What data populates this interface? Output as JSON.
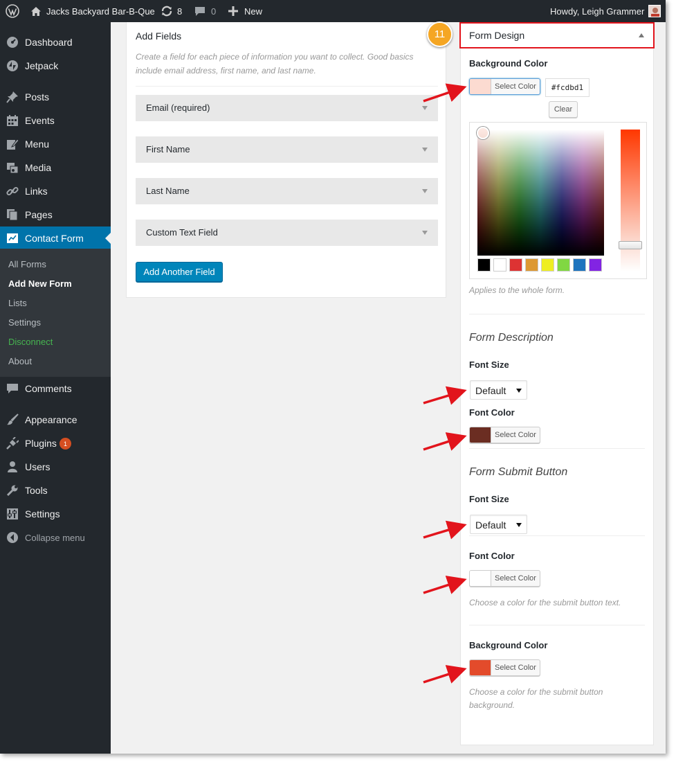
{
  "admin_bar": {
    "site_name": "Jacks Backyard Bar-B-Que",
    "updates_count": "8",
    "comments_count": "0",
    "new_label": "New",
    "howdy": "Howdy, Leigh Grammer"
  },
  "sidebar": {
    "items": [
      {
        "label": "Dashboard",
        "icon": "dashboard-icon"
      },
      {
        "label": "Jetpack",
        "icon": "jetpack-icon"
      },
      {
        "label": "Posts",
        "icon": "pin-icon"
      },
      {
        "label": "Events",
        "icon": "calendar-icon"
      },
      {
        "label": "Menu",
        "icon": "edit-icon"
      },
      {
        "label": "Media",
        "icon": "media-icon"
      },
      {
        "label": "Links",
        "icon": "link-icon"
      },
      {
        "label": "Pages",
        "icon": "pages-icon"
      },
      {
        "label": "Contact Form",
        "icon": "contact-form-icon"
      },
      {
        "label": "Comments",
        "icon": "comment-icon"
      },
      {
        "label": "Appearance",
        "icon": "brush-icon"
      },
      {
        "label": "Plugins",
        "icon": "plugin-icon",
        "badge": "1"
      },
      {
        "label": "Users",
        "icon": "user-icon"
      },
      {
        "label": "Tools",
        "icon": "wrench-icon"
      },
      {
        "label": "Settings",
        "icon": "settings-icon"
      },
      {
        "label": "Collapse menu",
        "icon": "collapse-icon"
      }
    ],
    "submenu": [
      "All Forms",
      "Add New Form",
      "Lists",
      "Settings",
      "Disconnect",
      "About"
    ]
  },
  "add_fields": {
    "title": "Add Fields",
    "description": "Create a field for each piece of information you want to collect. Good basics include email address, first name, and last name.",
    "fields": [
      "Email (required)",
      "First Name",
      "Last Name",
      "Custom Text Field"
    ],
    "add_button": "Add Another Field"
  },
  "form_design": {
    "title": "Form Design",
    "step_number": "11",
    "background_color": {
      "label": "Background Color",
      "button": "Select Color",
      "hex": "#fcdbd1",
      "clear": "Clear",
      "swatch": "#fcdbd1",
      "palette": [
        "#000000",
        "#ffffff",
        "#dd3333",
        "#dd9933",
        "#eeee22",
        "#81d742",
        "#1e73be",
        "#8224e3"
      ],
      "help": "Applies to the whole form."
    },
    "form_description": {
      "heading": "Form Description",
      "font_size_label": "Font Size",
      "font_size_value": "Default",
      "font_color_label": "Font Color",
      "font_color_button": "Select Color",
      "font_color_swatch": "#6b2d22"
    },
    "submit_button": {
      "heading": "Form Submit Button",
      "font_size_label": "Font Size",
      "font_size_value": "Default",
      "font_color_label": "Font Color",
      "font_color_button": "Select Color",
      "font_color_swatch": "#ffffff",
      "font_color_help": "Choose a color for the submit button text.",
      "bg_label": "Background Color",
      "bg_button": "Select Color",
      "bg_swatch": "#e34b2b",
      "bg_help": "Choose a color for the submit button background."
    }
  }
}
